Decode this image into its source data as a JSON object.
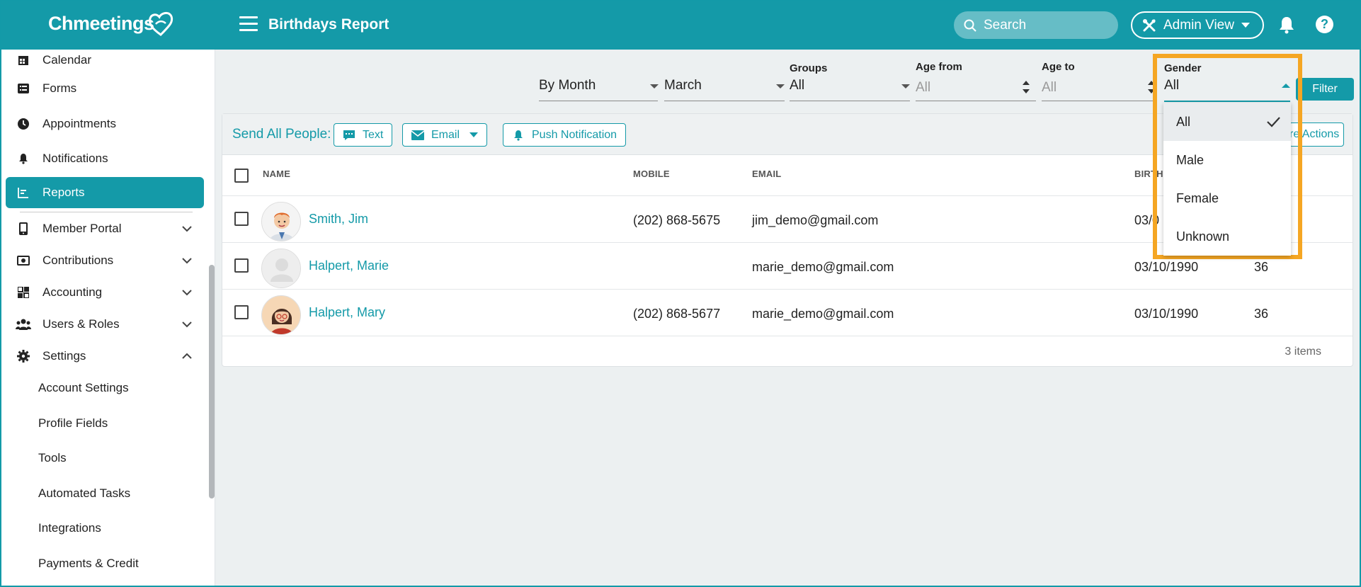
{
  "header": {
    "logo": "Chmeetings",
    "title": "Birthdays Report",
    "search_placeholder": "Search",
    "admin_view": "Admin View",
    "help": "?"
  },
  "sidebar": {
    "items": [
      {
        "label": "Calendar"
      },
      {
        "label": "Forms"
      },
      {
        "label": "Appointments"
      },
      {
        "label": "Notifications"
      },
      {
        "label": "Reports"
      },
      {
        "label": "Member Portal"
      },
      {
        "label": "Contributions"
      },
      {
        "label": "Accounting"
      },
      {
        "label": "Users & Roles"
      },
      {
        "label": "Settings"
      }
    ],
    "settings_sub": [
      {
        "label": "Account Settings"
      },
      {
        "label": "Profile Fields"
      },
      {
        "label": "Tools"
      },
      {
        "label": "Automated Tasks"
      },
      {
        "label": "Integrations"
      },
      {
        "label": "Payments & Credit"
      }
    ]
  },
  "filters": {
    "period": "By Month",
    "month": "March",
    "groups_label": "Groups",
    "groups_value": "All",
    "age_from_label": "Age from",
    "age_from_placeholder": "All",
    "age_to_label": "Age to",
    "age_to_placeholder": "All",
    "gender_label": "Gender",
    "gender_value": "All",
    "filter_button": "Filter",
    "gender_options": [
      "All",
      "Male",
      "Female",
      "Unknown"
    ]
  },
  "send_bar": {
    "label": "Send All People:",
    "text_btn": "Text",
    "email_btn": "Email",
    "push_btn": "Push Notification",
    "more_actions": "re Actions"
  },
  "table": {
    "columns": [
      "NAME",
      "MOBILE",
      "EMAIL",
      "BIRTH"
    ],
    "rows": [
      {
        "name": "Smith, Jim",
        "mobile": "(202) 868-5675",
        "email": "jim_demo@gmail.com",
        "birth": "03/0",
        "age": ""
      },
      {
        "name": "Halpert, Marie",
        "mobile": "",
        "email": "marie_demo@gmail.com",
        "birth": "03/10/1990",
        "age": "36"
      },
      {
        "name": "Halpert, Mary",
        "mobile": "(202) 868-5677",
        "email": "marie_demo@gmail.com",
        "birth": "03/10/1990",
        "age": "36"
      }
    ],
    "items_count": "3 items"
  },
  "colors": {
    "brand": "#149aa8",
    "highlight": "#f5a623"
  }
}
